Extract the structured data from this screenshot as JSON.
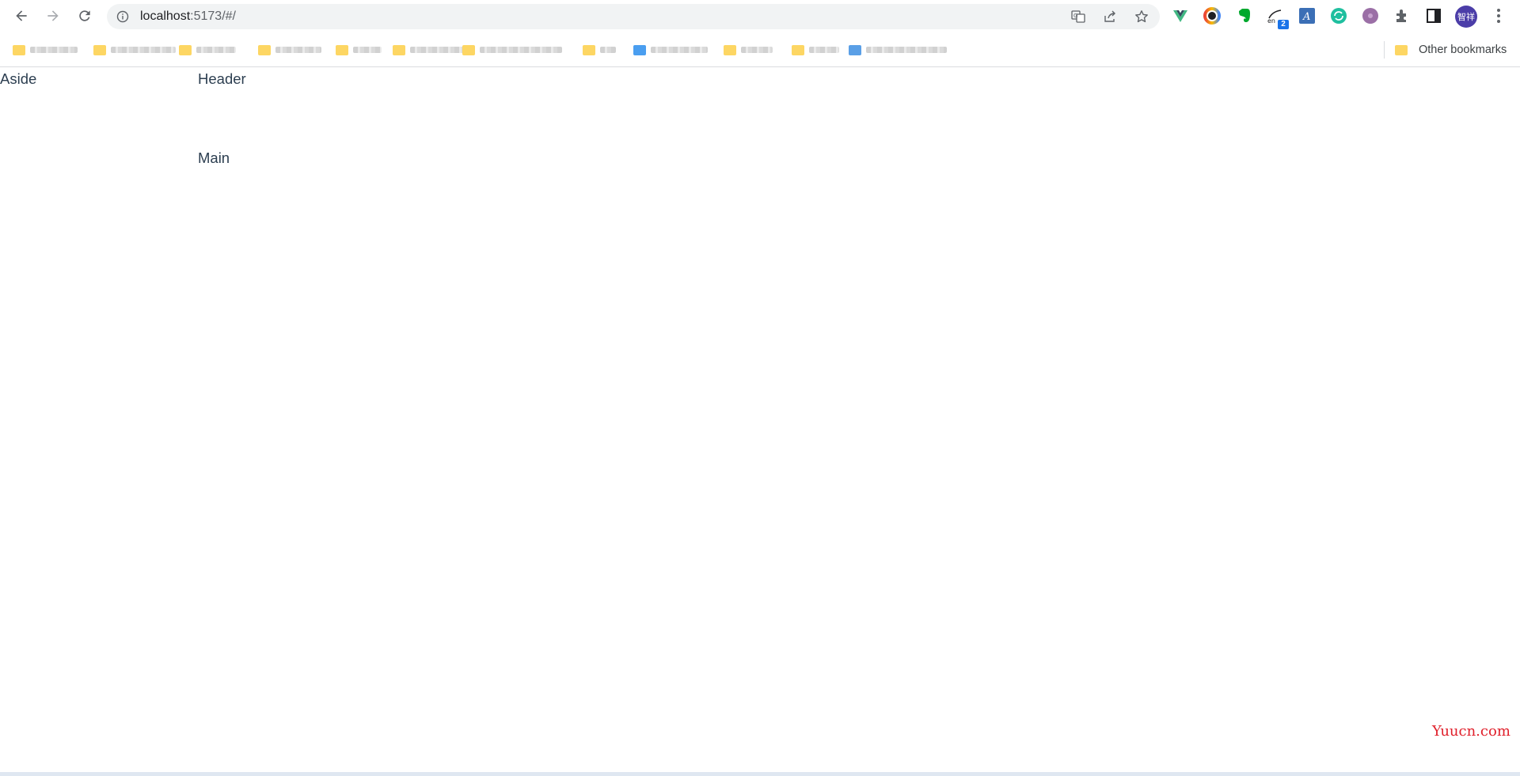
{
  "browser": {
    "url": {
      "host": "localhost",
      "rest": ":5173/#/"
    },
    "nav_icons": [
      "back-arrow-icon",
      "forward-arrow-icon",
      "reload-icon"
    ],
    "omnibox_icons": [
      "site-info-icon",
      "translate-icon",
      "share-icon",
      "bookmark-star-icon"
    ],
    "extensions": [
      "vue-devtools-icon",
      "color-picker-icon",
      "evernote-icon",
      "translate-extension-icon",
      "font-extension-icon",
      "refresh-extension-icon",
      "purple-extension-icon",
      "puzzle-extensions-icon",
      "side-panel-icon"
    ],
    "translate_badge": "2",
    "avatar_label": "智祥",
    "menu_icon": "more-vert-icon"
  },
  "bookmarks_bar": {
    "other_bookmarks": "Other bookmarks"
  },
  "page": {
    "aside": "Aside",
    "header": "Header",
    "main": "Main"
  },
  "watermark": "Yuucn.com",
  "colors": {
    "text": "#2c3e50",
    "folder_yellow": "#fdd663",
    "folder_blue": "#1a73e8",
    "watermark_red": "#e0202b",
    "avatar_bg": "#4b3da8"
  }
}
